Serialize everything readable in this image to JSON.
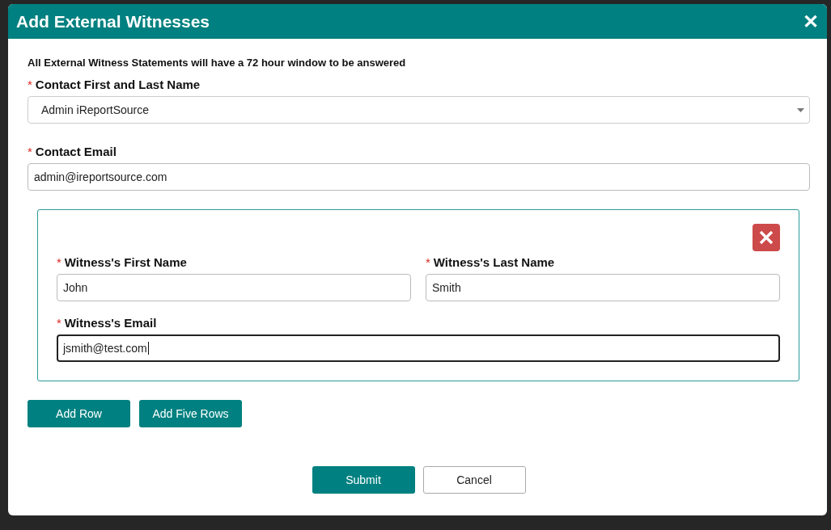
{
  "dialog": {
    "title": "Add External Witnesses",
    "close_label": "✕"
  },
  "notice": "All External Witness Statements will have a 72 hour window to be answered",
  "contact_name": {
    "label": "Contact First and Last Name",
    "required_mark": "*",
    "value": "Admin iReportSource"
  },
  "contact_email": {
    "label": "Contact Email",
    "required_mark": "*",
    "value": "admin@ireportsource.com"
  },
  "witness_rows": [
    {
      "first_name": {
        "label": "Witness's First Name",
        "required_mark": "*",
        "value": "John",
        "focused": false
      },
      "last_name": {
        "label": "Witness's Last Name",
        "required_mark": "*",
        "value": "Smith",
        "focused": false
      },
      "email": {
        "label": "Witness's Email",
        "required_mark": "*",
        "value": "jsmith@test.com",
        "focused": true
      }
    }
  ],
  "row_buttons": [
    "Add Row",
    "Add Five Rows"
  ],
  "footer_buttons": [
    {
      "label": "Submit",
      "kind": "primary"
    },
    {
      "label": "Cancel",
      "kind": "secondary"
    }
  ]
}
